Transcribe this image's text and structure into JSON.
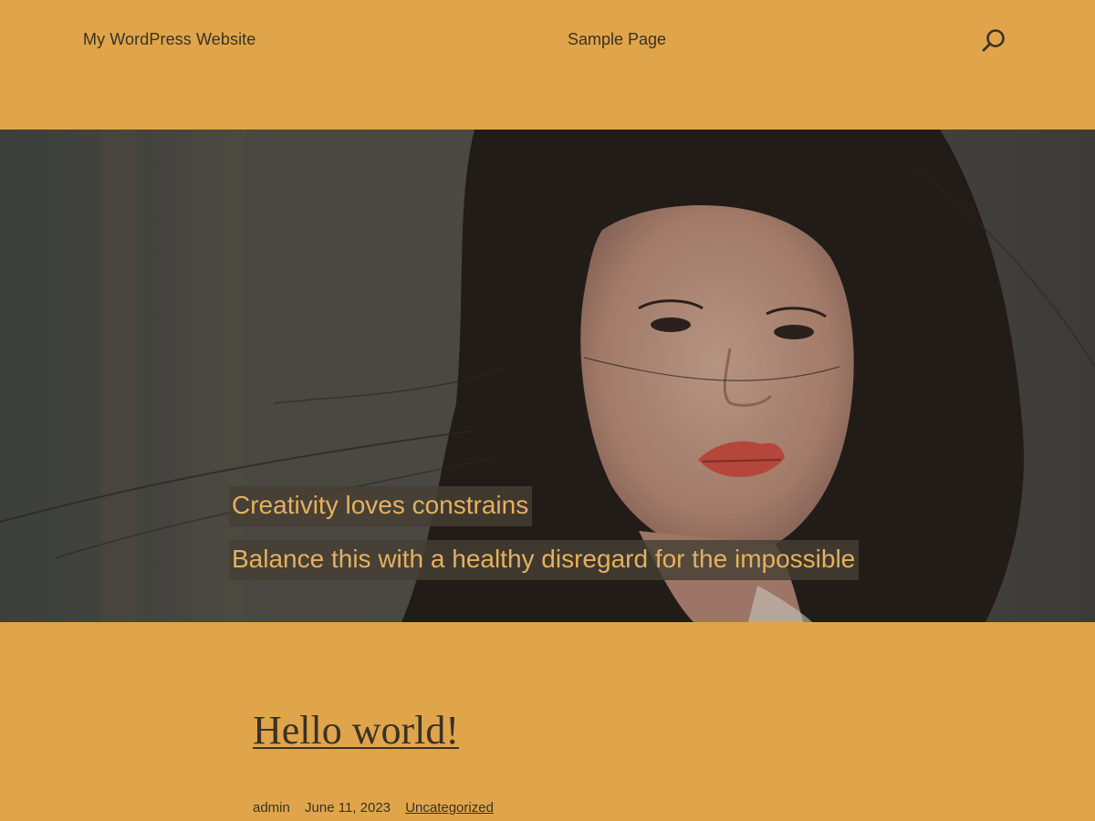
{
  "header": {
    "site_title": "My WordPress Website",
    "nav": [
      {
        "label": "Sample Page"
      }
    ],
    "search_icon": "search-icon"
  },
  "hero": {
    "lines": [
      "Creativity loves constrains",
      "Balance this with a healthy disregard for the impossible"
    ]
  },
  "post": {
    "title": "Hello world!",
    "author": "admin",
    "date": "June 11, 2023",
    "category": "Uncategorized"
  },
  "colors": {
    "background": "#e0a54a",
    "text": "#3a3226",
    "hero_text": "#e5b05d"
  }
}
